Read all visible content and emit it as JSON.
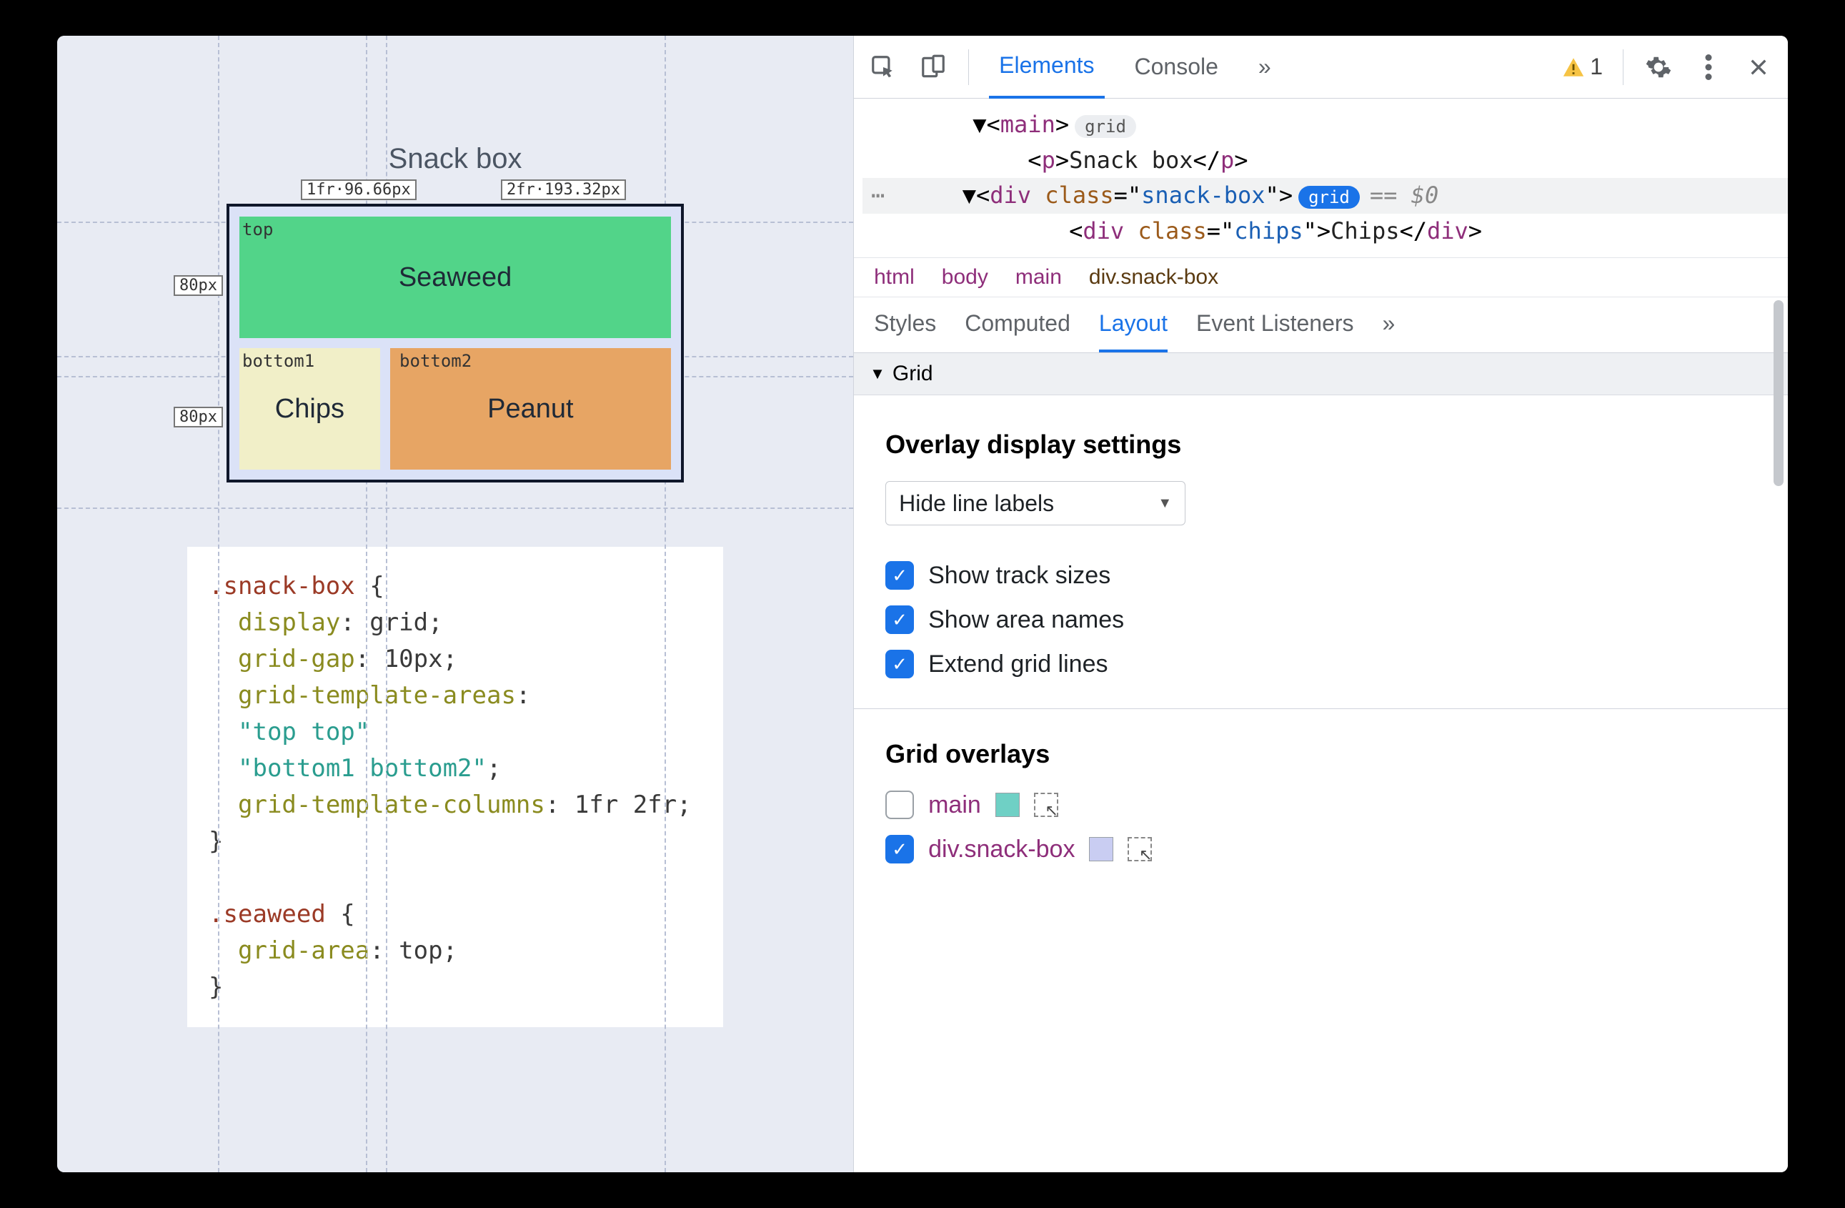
{
  "viewport": {
    "title": "Snack box",
    "grid": {
      "col_tracks": [
        "1fr·96.66px",
        "2fr·193.32px"
      ],
      "row_tracks": [
        "80px",
        "80px"
      ],
      "areas": {
        "top": "top",
        "bottom1": "bottom1",
        "bottom2": "bottom2"
      },
      "cells": {
        "seaweed": "Seaweed",
        "chips": "Chips",
        "peanut": "Peanut"
      }
    },
    "code": ".snack-box {\n  display: grid;\n  grid-gap: 10px;\n  grid-template-areas:\n  \"top top\"\n  \"bottom1 bottom2\";\n  grid-template-columns: 1fr 2fr;\n}\n\n.seaweed {\n  grid-area: top;\n}"
  },
  "devtools": {
    "tabs": {
      "elements": "Elements",
      "console": "Console",
      "more": "»"
    },
    "warning_count": "1",
    "dom": {
      "l1a": "▼",
      "l1_tag": "main",
      "l1_pill": "grid",
      "l2_tag": "p",
      "l2_text": "Snack box",
      "l3a": "▼",
      "l3_tag": "div",
      "l3_attr_n": "class",
      "l3_attr_v": "snack-box",
      "l3_pill": "grid",
      "l3_eq": "== $0",
      "l4_tag": "div",
      "l4_attr_n": "class",
      "l4_attr_v": "chips",
      "l4_text": "Chips"
    },
    "breadcrumbs": [
      "html",
      "body",
      "main",
      "div.snack-box"
    ],
    "sub_tabs": {
      "styles": "Styles",
      "computed": "Computed",
      "layout": "Layout",
      "listeners": "Event Listeners",
      "more": "»"
    },
    "section": "Grid",
    "overlay": {
      "heading": "Overlay display settings",
      "select": "Hide line labels",
      "opt_track": "Show track sizes",
      "opt_area": "Show area names",
      "opt_extend": "Extend grid lines"
    },
    "grid_overlays": {
      "heading": "Grid overlays",
      "items": [
        {
          "label": "main",
          "checked": false,
          "swatch": "teal"
        },
        {
          "label": "div.snack-box",
          "checked": true,
          "swatch": "lilac"
        }
      ]
    }
  }
}
